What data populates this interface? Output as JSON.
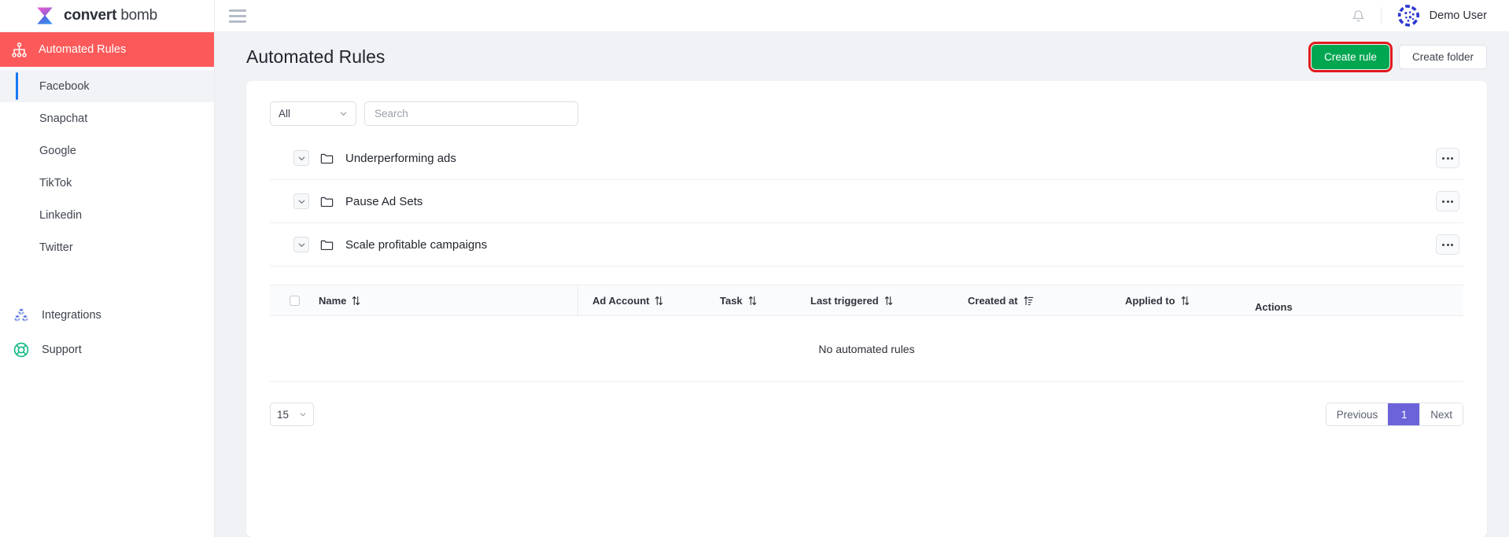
{
  "brand": {
    "name_bold": "convert",
    "name_light": " bomb",
    "logo_icon": "hourglass-logo-icon"
  },
  "sidebar": {
    "primary": {
      "label": "Automated Rules",
      "icon": "sitemap-icon",
      "accent": "#fc5a5a"
    },
    "channels": [
      {
        "label": "Facebook",
        "active": true
      },
      {
        "label": "Snapchat",
        "active": false
      },
      {
        "label": "Google",
        "active": false
      },
      {
        "label": "TikTok",
        "active": false
      },
      {
        "label": "Linkedin",
        "active": false
      },
      {
        "label": "Twitter",
        "active": false
      }
    ],
    "bottom": [
      {
        "label": "Integrations",
        "icon": "cubes-icon",
        "color": "#5a77e0"
      },
      {
        "label": "Support",
        "icon": "lifebuoy-icon",
        "color": "#12b886"
      }
    ]
  },
  "topbar": {
    "menu_icon": "hamburger-icon",
    "notifications_icon": "bell-icon",
    "avatar_icon": "identicon-avatar",
    "username": "Demo User"
  },
  "page": {
    "title": "Automated Rules",
    "create_rule_label": "Create rule",
    "create_folder_label": "Create folder",
    "create_rule_color": "#00a650",
    "highlight_color": "#e01b1b"
  },
  "filters": {
    "channel_select_value": "All",
    "channel_select_icon": "chevron-down-icon",
    "search_placeholder": "Search",
    "search_value": ""
  },
  "folders": [
    {
      "name": "Underperforming ads",
      "expand_icon": "chevron-down-icon",
      "icon": "folder-icon",
      "actions_icon": "ellipsis-icon"
    },
    {
      "name": "Pause Ad Sets",
      "expand_icon": "chevron-down-icon",
      "icon": "folder-icon",
      "actions_icon": "ellipsis-icon"
    },
    {
      "name": "Scale profitable campaigns",
      "expand_icon": "chevron-down-icon",
      "icon": "folder-icon",
      "actions_icon": "ellipsis-icon"
    }
  ],
  "table": {
    "select_all_icon": "checkbox-icon",
    "columns": [
      {
        "label": "Name",
        "sort_icon": "sort-updown-icon"
      },
      {
        "label": "Ad Account",
        "sort_icon": "sort-updown-icon"
      },
      {
        "label": "Task",
        "sort_icon": "sort-updown-icon"
      },
      {
        "label": "Last triggered",
        "sort_icon": "sort-updown-icon"
      },
      {
        "label": "Created at",
        "sort_icon": "sort-ascending-lines-icon"
      },
      {
        "label": "Applied to",
        "sort_icon": "sort-updown-icon"
      },
      {
        "label": "Actions",
        "sort_icon": ""
      }
    ],
    "empty_message": "No automated rules",
    "rows": []
  },
  "pagination": {
    "page_size": "15",
    "page_size_icon": "chevron-down-icon",
    "previous_label": "Previous",
    "current_page": "1",
    "next_label": "Next",
    "active_color": "#6c63d8"
  }
}
